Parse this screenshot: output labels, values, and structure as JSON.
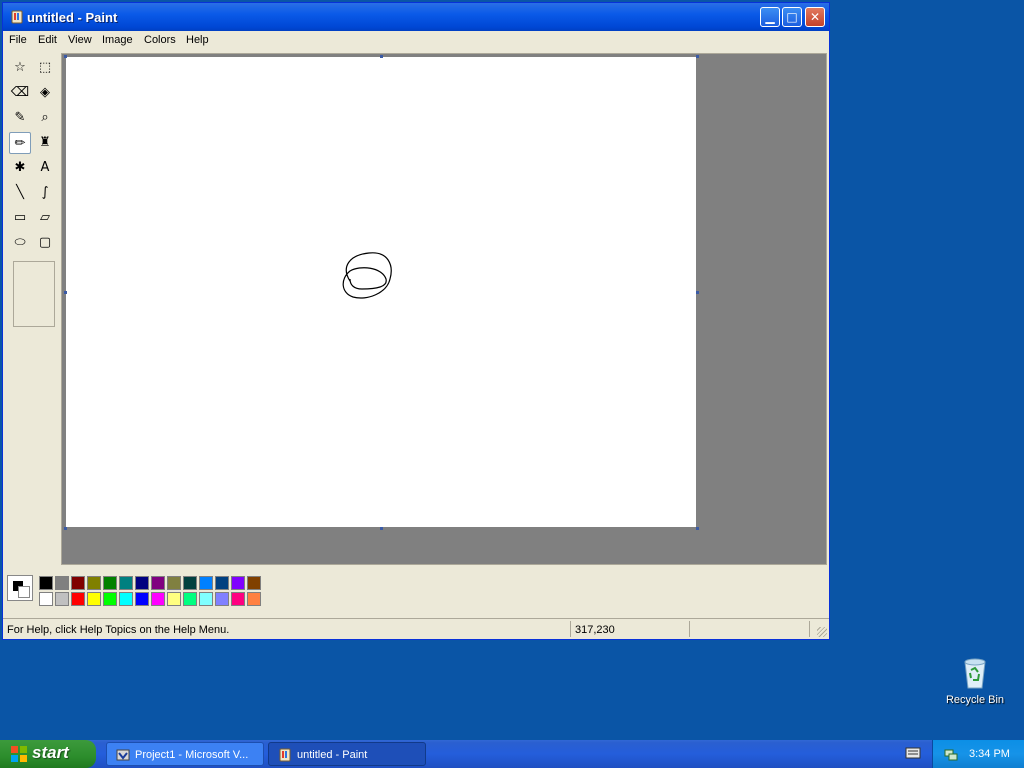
{
  "window": {
    "title": "untitled - Paint",
    "controls": {
      "minimize": "▁",
      "maximize": "□",
      "close": "✕"
    }
  },
  "menu": [
    "File",
    "Edit",
    "View",
    "Image",
    "Colors",
    "Help"
  ],
  "tools": [
    {
      "name": "free-form-select-icon",
      "glyph": "☆"
    },
    {
      "name": "select-icon",
      "glyph": "⬚"
    },
    {
      "name": "eraser-icon",
      "glyph": "⌫"
    },
    {
      "name": "fill-icon",
      "glyph": "◈"
    },
    {
      "name": "pick-color-icon",
      "glyph": "✎"
    },
    {
      "name": "magnifier-icon",
      "glyph": "⌕"
    },
    {
      "name": "pencil-icon",
      "glyph": "✏"
    },
    {
      "name": "brush-icon",
      "glyph": "♜"
    },
    {
      "name": "airbrush-icon",
      "glyph": "✱"
    },
    {
      "name": "text-icon",
      "glyph": "A"
    },
    {
      "name": "line-icon",
      "glyph": "╲"
    },
    {
      "name": "curve-icon",
      "glyph": "∫"
    },
    {
      "name": "rectangle-icon",
      "glyph": "▭"
    },
    {
      "name": "polygon-icon",
      "glyph": "▱"
    },
    {
      "name": "ellipse-icon",
      "glyph": "⬭"
    },
    {
      "name": "rounded-rectangle-icon",
      "glyph": "▢"
    }
  ],
  "active_tool": "pencil-icon",
  "palette": {
    "top": [
      "#000000",
      "#808080",
      "#800000",
      "#808000",
      "#008000",
      "#008080",
      "#000080",
      "#800080",
      "#808040",
      "#004040",
      "#0080ff",
      "#004080",
      "#8000ff",
      "#804000"
    ],
    "bottom": [
      "#ffffff",
      "#c0c0c0",
      "#ff0000",
      "#ffff00",
      "#00ff00",
      "#00ffff",
      "#0000ff",
      "#ff00ff",
      "#ffff80",
      "#00ff80",
      "#80ffff",
      "#8080ff",
      "#ff0080",
      "#ff8040"
    ],
    "foreground": "#000000",
    "background": "#ffffff"
  },
  "status": {
    "help": "For Help, click Help Topics on the Help Menu.",
    "coords": "317,230"
  },
  "desktop": {
    "recycle_bin": "Recycle Bin"
  },
  "taskbar": {
    "start": "start",
    "tasks": [
      "Project1 - Microsoft V...",
      "untitled - Paint"
    ],
    "clock": "3:34 PM"
  }
}
